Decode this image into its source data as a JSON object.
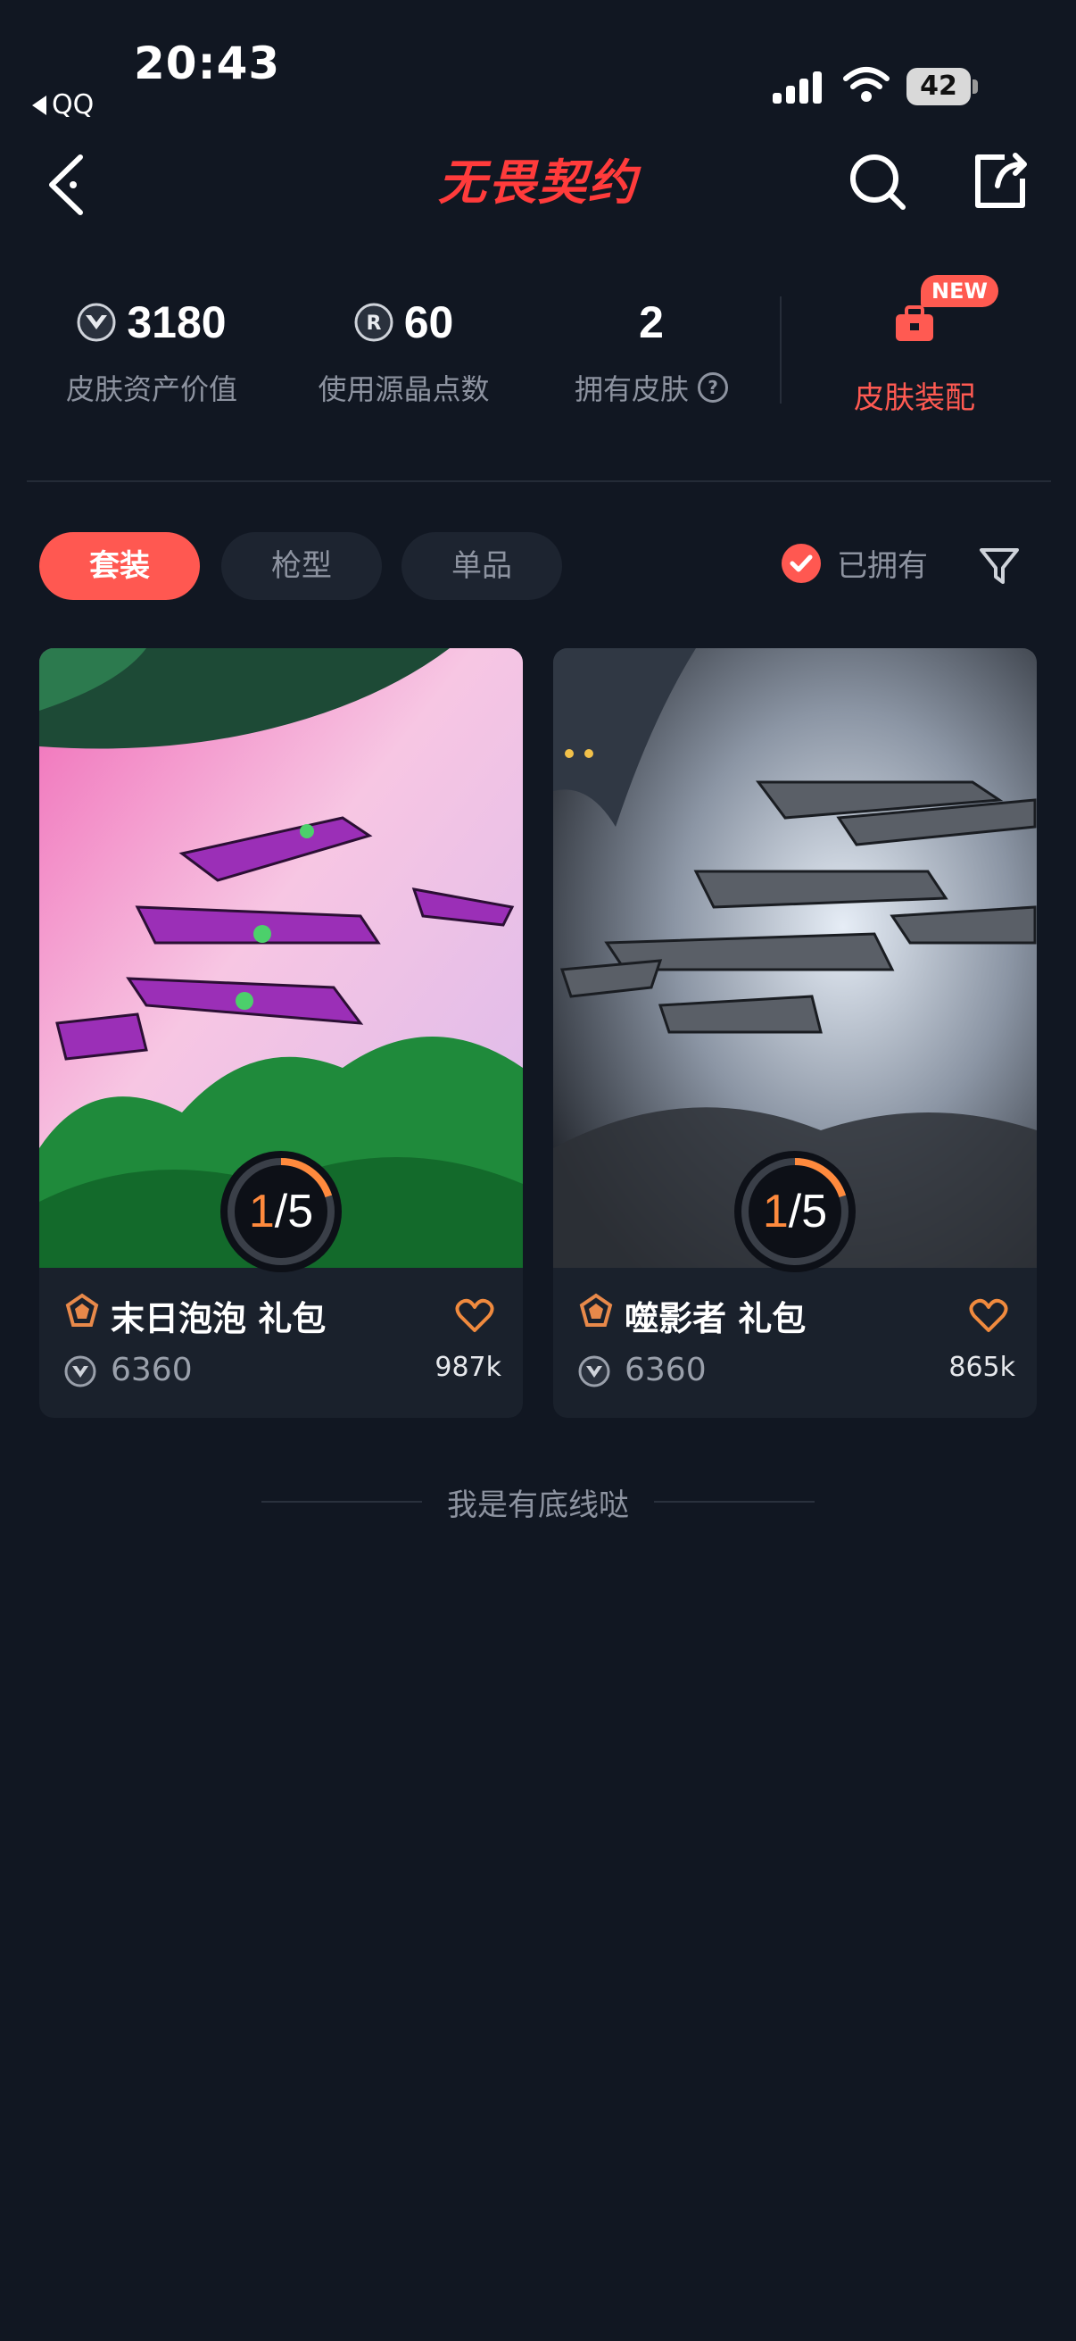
{
  "status_bar": {
    "time": "20:43",
    "back_app": "QQ",
    "battery": "42"
  },
  "header": {
    "logo_text": "无畏契约"
  },
  "stats": [
    {
      "value": "3180",
      "label": "皮肤资产价值",
      "icon": "valorant-points-icon"
    },
    {
      "value": "60",
      "label": "使用源晶点数",
      "icon": "radianite-icon"
    },
    {
      "value": "2",
      "label": "拥有皮肤",
      "icon": "help-icon"
    }
  ],
  "equip": {
    "label": "皮肤装配",
    "badge": "NEW"
  },
  "tabs": [
    {
      "label": "套装",
      "active": true
    },
    {
      "label": "枪型",
      "active": false
    },
    {
      "label": "单品",
      "active": false
    }
  ],
  "owned_filter": {
    "label": "已拥有",
    "checked": true
  },
  "cards": [
    {
      "title": "末日泡泡 礼包",
      "progress_owned": "1",
      "progress_total": "5",
      "progress_sep": "/",
      "price": "6360",
      "likes": "987k"
    },
    {
      "title": "噬影者 礼包",
      "progress_owned": "1",
      "progress_total": "5",
      "progress_sep": "/",
      "price": "6360",
      "likes": "865k"
    }
  ],
  "footer": {
    "text": "我是有底线哒"
  },
  "colors": {
    "accent": "#ff5851",
    "background": "#111722",
    "card": "#1a212c",
    "progress": "#ff8a3d"
  }
}
